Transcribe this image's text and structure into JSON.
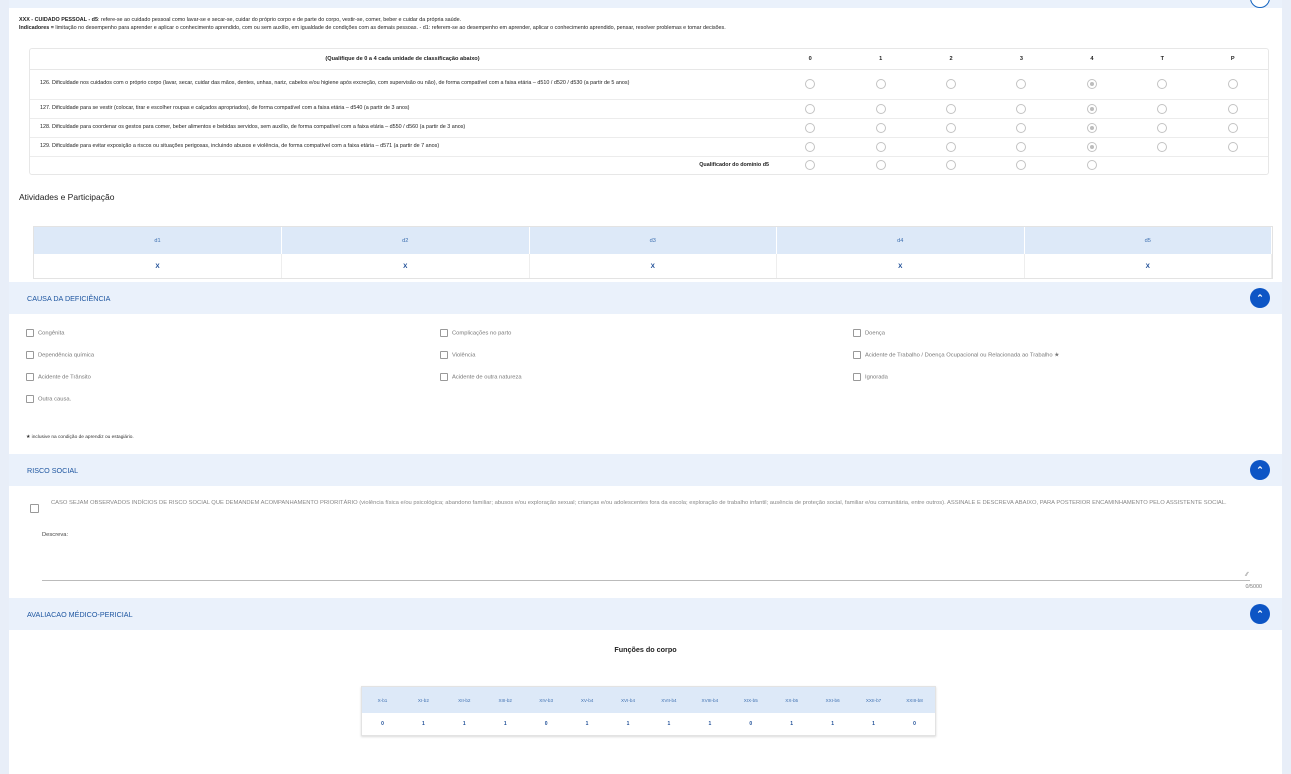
{
  "intro": {
    "line1_bold": "XXX - CUIDADO PESSOAL - d5",
    "line1_rest": ": refere-se ao cuidado pessoal como lavar-se e secar-se, cuidar do próprio corpo e de parte do corpo, vestir-se, comer, beber e cuidar da própria saúde.",
    "line2_bold": "Indicadores =",
    "line2_rest": " limitação no desempenho para aprender e aplicar o conhecimento aprendido, com ou sem auxílio, em igualdade de condições com as demais pessoas. - d1: referem-se ao desempenho em aprender, aplicar o conhecimento aprendido, pensar, resolver problemas e tomar decisões."
  },
  "qualification_table": {
    "header": "(Qualifique de 0 a 4 cada unidade de classificação abaixo)",
    "columns": [
      "0",
      "1",
      "2",
      "3",
      "4",
      "T",
      "P"
    ],
    "rows": [
      {
        "text": "126. Dificuldade nos cuidados com o próprio corpo (lavar, secar, cuidar das mãos, dentes, unhas, nariz, cabelos e/ou higiene após excreção, com supervisão ou não), de forma compatível com a faixa etária – d510 / d520 / d530 (a partir de 5 anos)",
        "selected": "4"
      },
      {
        "text": "127. Dificuldade para se vestir (colocar, tirar e escolher roupas e calçados apropriados), de forma compatível com a faixa etária – d540 (a partir de 3 anos)",
        "selected": "4"
      },
      {
        "text": "128. Dificuldade para coordenar os gestos para comer, beber alimentos e bebidas servidos, sem auxílio, de forma compatível com a faixa etária – d550 / d560 (a partir de 3 anos)",
        "selected": "4"
      },
      {
        "text": "129. Dificuldade para evitar exposição a riscos ou situações perigosas, incluindo abusos e violência, de forma compatível com a faixa etária – d571 (a partir de 7 anos)",
        "selected": "4"
      }
    ],
    "qualifier_label": "Qualificador do domínio d5"
  },
  "atividades": {
    "title": "Atividades e Participação",
    "headers": [
      "d1",
      "d2",
      "d3",
      "d4",
      "d5"
    ],
    "values": [
      "X",
      "X",
      "X",
      "X",
      "X"
    ]
  },
  "causa": {
    "title": "CAUSA DA DEFICIÊNCIA",
    "options": [
      "Congênita",
      "Complicações no parto",
      "Doença",
      "Dependência química",
      "Violência",
      "Acidente de Trabalho / Doença Ocupacional ou Relacionada ao Trabalho ★",
      "Acidente de Trânsito",
      "Acidente de outra natureza",
      "Ignorada",
      "Outra causa."
    ],
    "footnote": "★ inclusive na condição de aprendiz ou estagiário."
  },
  "risco": {
    "title": "RISCO SOCIAL",
    "checkbox_text": "CASO SEJAM OBSERVADOS INDÍCIOS DE RISCO SOCIAL QUE DEMANDEM ACOMPANHAMENTO PRIORITÁRIO (violência física e/ou psicológica; abandono familiar; abusos e/ou exploração sexual; crianças e/ou adolescentes fora da escola; exploração de trabalho infantil; ausência de proteção social, familiar e/ou comunitária, entre outros). ASSINALE E DESCREVA ABAIXO, PARA POSTERIOR ENCAMINHAMENTO PELO ASSISTENTE SOCIAL.",
    "describe_label": "Descreva:",
    "counter": "0/5000"
  },
  "avaliacao": {
    "title": "AVALIACAO MÉDICO-PERICIAL",
    "subtitle": "Funções do corpo",
    "headers": [
      "X-b1",
      "XI-b2",
      "XII-b2",
      "XIII-b2",
      "XIV-b3",
      "XV-b4",
      "XVI-b4",
      "XVII-b4",
      "XVIII-b4",
      "XIX-b5",
      "XX-b5",
      "XXI-b6",
      "XXII-b7",
      "XXIII-b8"
    ],
    "values": [
      "0",
      "1",
      "1",
      "1",
      "0",
      "1",
      "1",
      "1",
      "1",
      "0",
      "1",
      "1",
      "1",
      "0"
    ]
  },
  "icons": {
    "collapse": "chevron-up-icon"
  }
}
